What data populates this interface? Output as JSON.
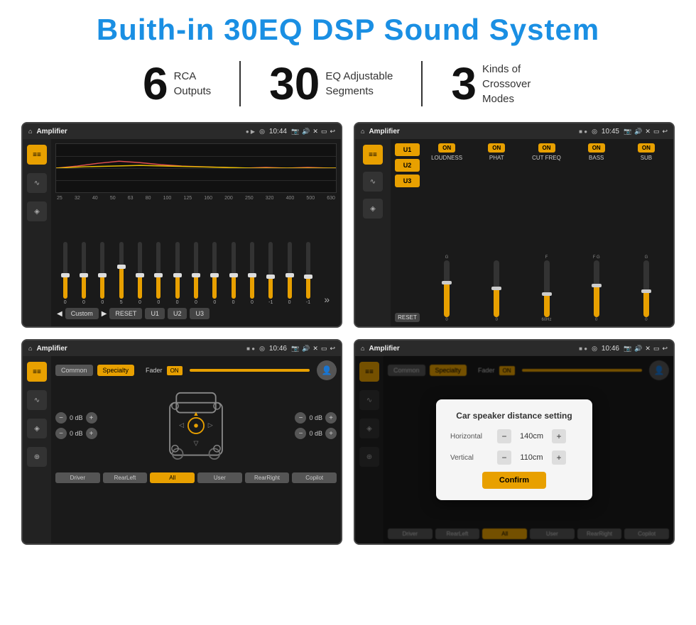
{
  "page": {
    "title": "Buith-in 30EQ DSP Sound System"
  },
  "stats": [
    {
      "number": "6",
      "line1": "RCA",
      "line2": "Outputs"
    },
    {
      "number": "30",
      "line1": "EQ Adjustable",
      "line2": "Segments"
    },
    {
      "number": "3",
      "line1": "Kinds of",
      "line2": "Crossover Modes"
    }
  ],
  "screens": {
    "screen1": {
      "title": "Amplifier",
      "time": "10:44",
      "eq_labels": [
        "25",
        "32",
        "40",
        "50",
        "63",
        "80",
        "100",
        "125",
        "160",
        "200",
        "250",
        "320",
        "400",
        "500",
        "630"
      ],
      "eq_values": [
        "0",
        "0",
        "0",
        "5",
        "0",
        "0",
        "0",
        "0",
        "0",
        "0",
        "0",
        "-1",
        "0",
        "-1"
      ],
      "bottom_btns": [
        "Custom",
        "RESET",
        "U1",
        "U2",
        "U3"
      ]
    },
    "screen2": {
      "title": "Amplifier",
      "time": "10:45",
      "presets": [
        "U1",
        "U2",
        "U3"
      ],
      "channels": [
        "LOUDNESS",
        "PHAT",
        "CUT FREQ",
        "BASS",
        "SUB"
      ],
      "reset_btn": "RESET"
    },
    "screen3": {
      "title": "Amplifier",
      "time": "10:46",
      "tabs": [
        "Common",
        "Specialty"
      ],
      "fader_label": "Fader",
      "fader_on": "ON",
      "bottom_btns": [
        "Driver",
        "RearLeft",
        "All",
        "User",
        "RearRight",
        "Copilot"
      ]
    },
    "screen4": {
      "title": "Amplifier",
      "time": "10:46",
      "tabs": [
        "Common",
        "Specialty"
      ],
      "dialog": {
        "title": "Car speaker distance setting",
        "row1_label": "Horizontal",
        "row1_value": "140cm",
        "row2_label": "Vertical",
        "row2_value": "110cm",
        "confirm_btn": "Confirm"
      },
      "bottom_btns": [
        "Driver",
        "RearLeft",
        "All",
        "User",
        "RearRight",
        "Copilot"
      ]
    }
  },
  "icons": {
    "home": "⌂",
    "location": "◎",
    "sound": "♪",
    "back": "↩",
    "camera": "📷",
    "volume": "🔊",
    "menu": "☰",
    "eq_icon": "≡",
    "wave_icon": "∿",
    "speaker_icon": "◈",
    "arrows_icon": "⊕"
  }
}
